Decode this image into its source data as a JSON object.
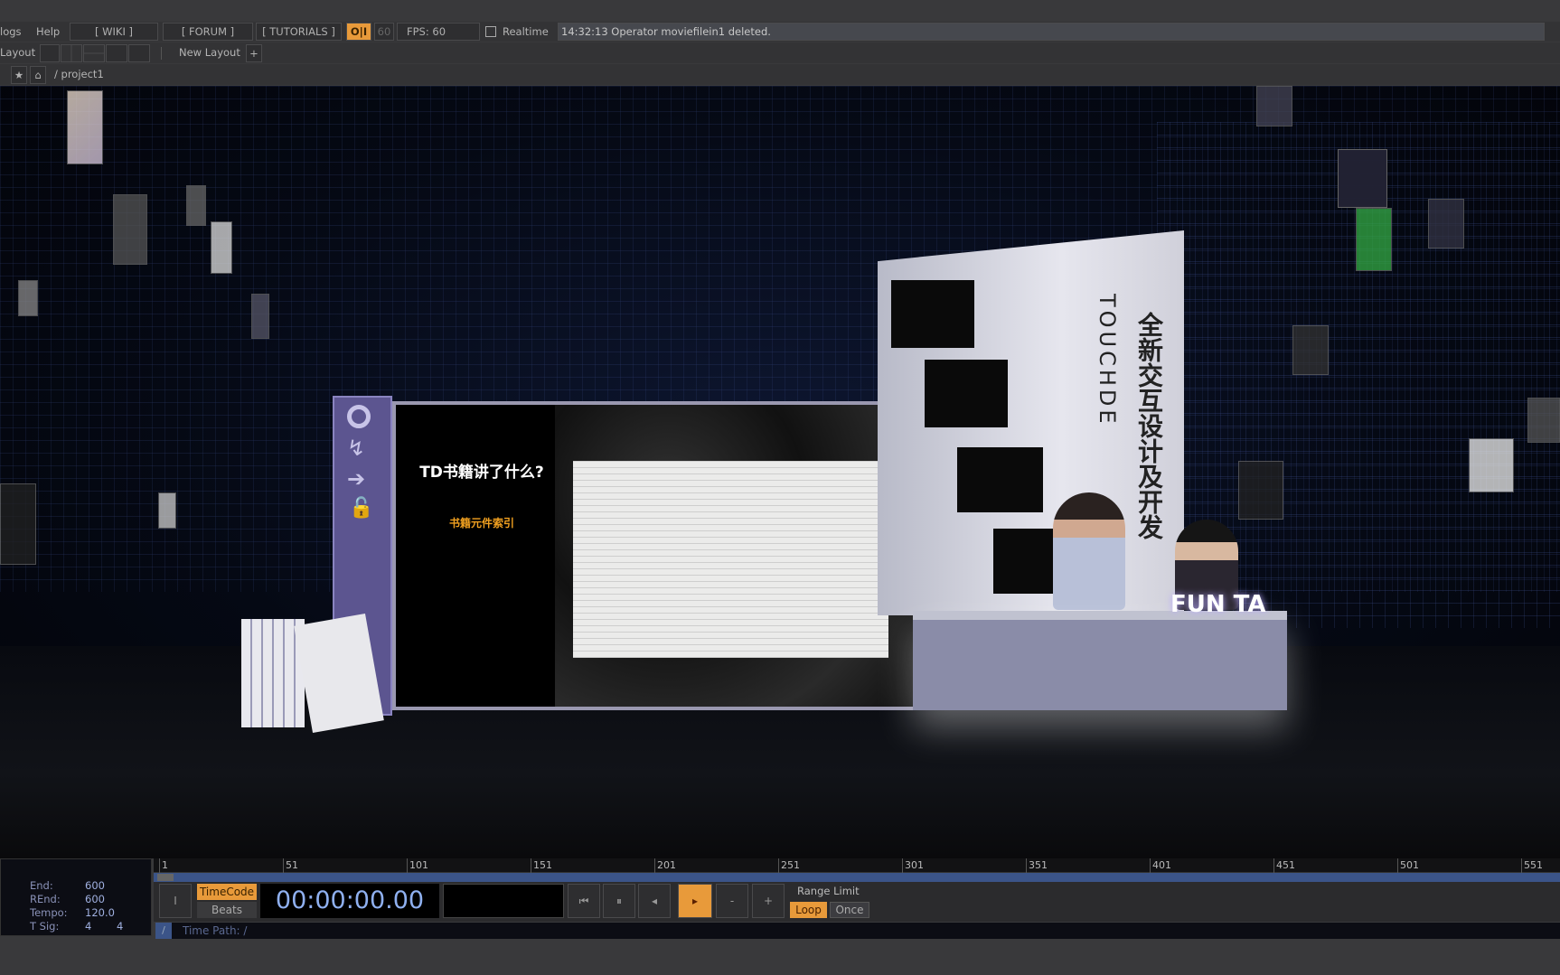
{
  "menu": {
    "items": [
      "logs",
      "Help"
    ],
    "wiki": "[ WIKI ]",
    "forum": "[ FORUM ]",
    "tutorials": "[ TUTORIALS ]",
    "oi": "O|I",
    "fps_target": "60",
    "fps": "FPS:  60",
    "realtime": "Realtime",
    "status": "14:32:13 Operator moviefilein1 deleted."
  },
  "layout": {
    "label": "Layout",
    "new_layout": "New Layout",
    "add": "+"
  },
  "path": {
    "text": "/ project1"
  },
  "scene": {
    "screen_title": "TD书籍讲了什么?",
    "screen_subtitle": "书籍元件索引",
    "wall_brand": "TOUCHDE",
    "wall_cn": "全新交互设计及开发",
    "desk_logo": "FUN TA",
    "accent": "#f0a020",
    "purple": "#6b62b0"
  },
  "timeline": {
    "ticks": [
      "1",
      "51",
      "101",
      "151",
      "201",
      "251",
      "301",
      "351",
      "401",
      "451",
      "501",
      "551"
    ],
    "info": {
      "end_label": "End:",
      "end": "600",
      "rend_label": "REnd:",
      "rend": "600",
      "tempo_label": "Tempo:",
      "tempo": "120.0",
      "tsig_label": "T Sig:",
      "tsig_a": "4",
      "tsig_b": "4"
    },
    "timecode_btn": "TimeCode",
    "beats_btn": "Beats",
    "timecode": "00:00:00.00",
    "range_limit": "Range Limit",
    "loop": "Loop",
    "once": "Once",
    "minus": "-",
    "plus": "+",
    "time_path": "Time Path: /",
    "slash": "/"
  }
}
